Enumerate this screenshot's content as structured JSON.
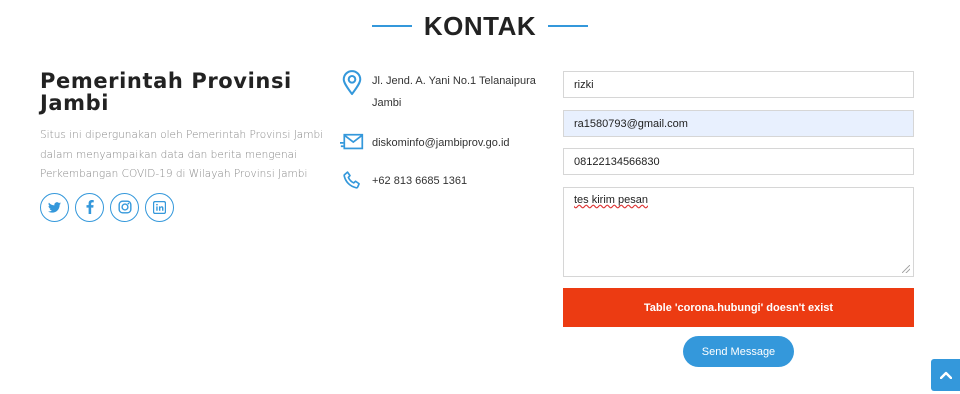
{
  "section": {
    "title": "KONTAK",
    "accent_color": "#3498db"
  },
  "org": {
    "name": "Pemerintah Provinsi Jambi",
    "description": "Situs ini dipergunakan oleh Pemerintah Provinsi Jambi dalam menyampaikan data dan berita mengenai Perkembangan COVID-19 di Wilayah Provinsi Jambi",
    "socials": [
      {
        "icon": "twitter-icon"
      },
      {
        "icon": "facebook-icon"
      },
      {
        "icon": "instagram-icon"
      },
      {
        "icon": "linkedin-icon"
      }
    ]
  },
  "contact": {
    "address": "Jl. Jend. A. Yani No.1 Telanaipura Jambi",
    "email": "diskominfo@jambiprov.go.id",
    "phone": "+62 813 6685 1361"
  },
  "form": {
    "name_value": "rizki",
    "email_value": "ra1580793@gmail.com",
    "phone_value": "08122134566830",
    "message_value": "tes kirim pesan",
    "error_message": "Table 'corona.hubungi' doesn't exist",
    "error_color": "#ec3b12",
    "submit_label": "Send Message"
  },
  "back_to_top": {
    "icon": "chevron-up-icon"
  }
}
